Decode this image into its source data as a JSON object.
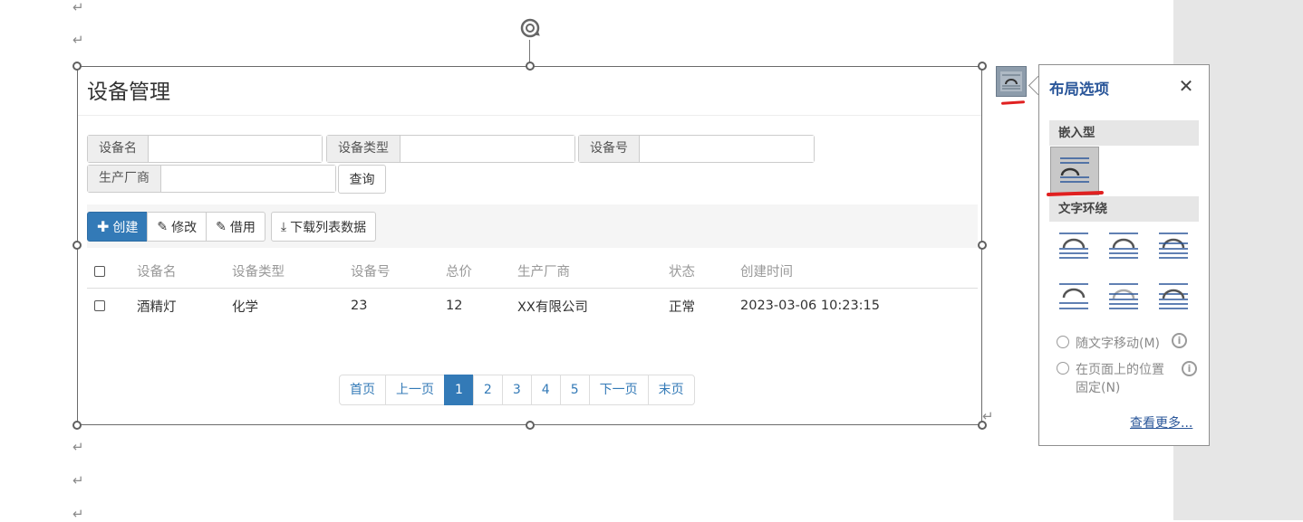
{
  "document": {
    "paragraph_mark": "↵"
  },
  "embedded_app": {
    "title": "设备管理",
    "filters": [
      {
        "label": "设备名",
        "value": ""
      },
      {
        "label": "设备类型",
        "value": ""
      },
      {
        "label": "设备号",
        "value": ""
      },
      {
        "label": "生产厂商",
        "value": ""
      }
    ],
    "query_button": "查询",
    "toolbar": {
      "create": "创建",
      "edit": "修改",
      "borrow": "借用",
      "download": "下载列表数据"
    },
    "table": {
      "columns": [
        "设备名",
        "设备类型",
        "设备号",
        "总价",
        "生产厂商",
        "状态",
        "创建时间"
      ],
      "rows": [
        [
          "酒精灯",
          "化学",
          "23",
          "12",
          "XX有限公司",
          "正常",
          "2023-03-06 10:23:15"
        ]
      ]
    },
    "pagination": {
      "first": "首页",
      "prev": "上一页",
      "pages": [
        "1",
        "2",
        "3",
        "4",
        "5"
      ],
      "current": "1",
      "next": "下一页",
      "last": "末页"
    }
  },
  "layout_options": {
    "title": "布局选项",
    "inline_section": "嵌入型",
    "wrap_section": "文字环绕",
    "move_with_text": "随文字移动(M)",
    "fix_position_line1": "在页面上的位置",
    "fix_position_line2": "固定(N)",
    "see_more": "查看更多..."
  },
  "colors": {
    "primary": "#337ab7",
    "word_blue": "#2b579a",
    "annotation_red": "#e02020"
  }
}
